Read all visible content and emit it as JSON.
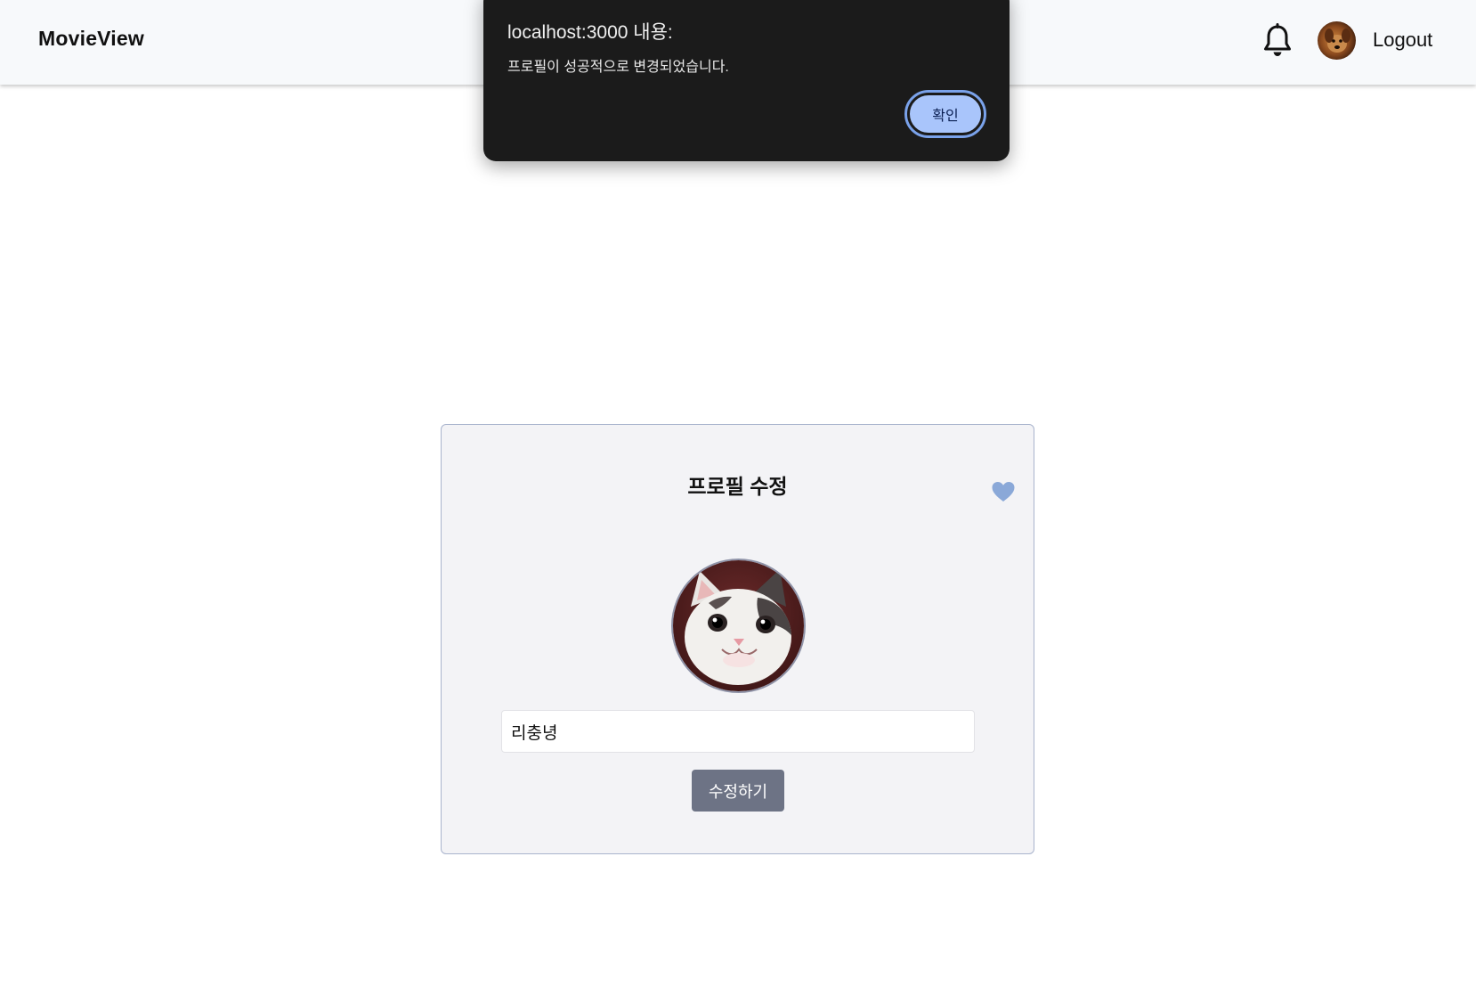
{
  "header": {
    "brand": "MovieView",
    "logout_label": "Logout",
    "icons": {
      "bell": "bell-icon",
      "avatar": "user-avatar"
    }
  },
  "alert": {
    "title": "localhost:3000 내용:",
    "message": "프로필이 성공적으로 변경되었습니다.",
    "ok_label": "확인"
  },
  "profile_card": {
    "title": "프로필 수정",
    "nickname_value": "리충녕",
    "submit_label": "수정하기",
    "icons": {
      "heart": "heart-icon",
      "profile_photo": "cat-profile-photo"
    }
  },
  "colors": {
    "header_bg": "#f7f9fb",
    "dialog_bg": "#1b1b1b",
    "dialog_button": "#a9c5fb",
    "card_bg": "#f3f3f6",
    "card_border": "#a9b4cd",
    "heart": "#8aa8d8",
    "submit_button": "#6d7385"
  }
}
